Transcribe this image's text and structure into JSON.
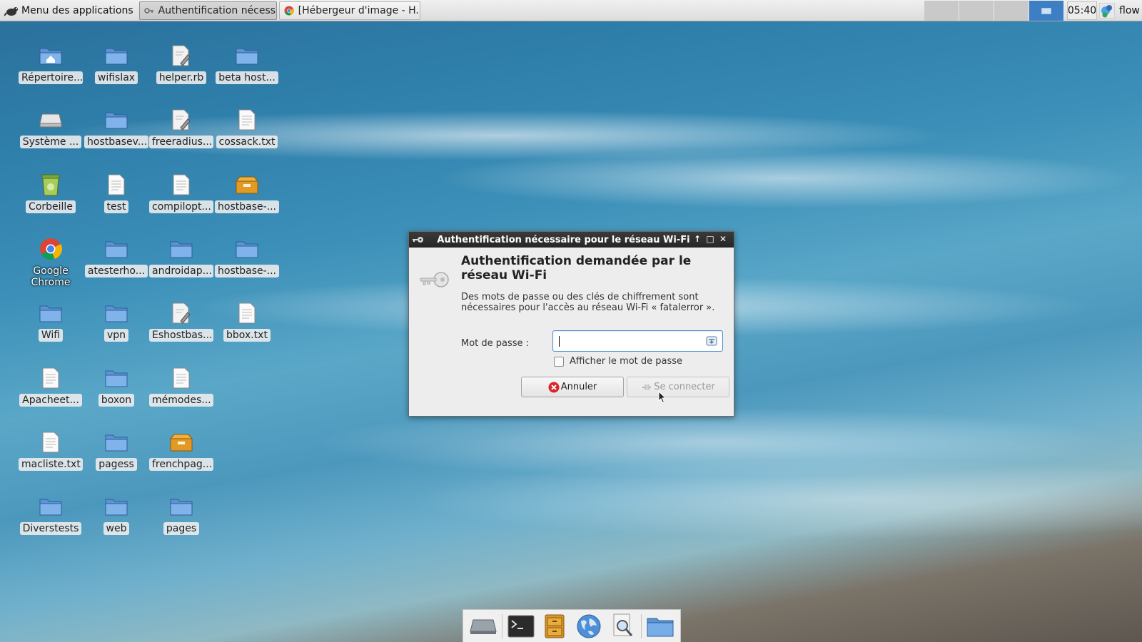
{
  "top_panel": {
    "app_menu_label": "Menu des applications",
    "tasks": [
      {
        "label": "Authentification nécess...",
        "active": true
      },
      {
        "label": "[Hébergeur d'image - H...",
        "active": false
      }
    ],
    "clock": "05:40",
    "user": "flow",
    "workspace_count": 4,
    "active_workspace": 4
  },
  "desktop": {
    "icons": [
      {
        "label": "Répertoire...",
        "type": "home-folder-icon"
      },
      {
        "label": "wifislax",
        "type": "folder-icon"
      },
      {
        "label": "helper.rb",
        "type": "script-file-icon"
      },
      {
        "label": "beta host...",
        "type": "folder-icon"
      },
      {
        "label": "Système ...",
        "type": "drive-icon"
      },
      {
        "label": "hostbasev...",
        "type": "folder-icon"
      },
      {
        "label": "freeradius...",
        "type": "script-file-icon"
      },
      {
        "label": "cossack.txt",
        "type": "text-file-icon"
      },
      {
        "label": "Corbeille",
        "type": "trash-icon"
      },
      {
        "label": "test",
        "type": "text-file-icon"
      },
      {
        "label": "compilopt...",
        "type": "text-file-icon"
      },
      {
        "label": "hostbase-...",
        "type": "package-icon"
      },
      {
        "label": "Google Chrome",
        "type": "chrome-icon"
      },
      {
        "label": "atesterho...",
        "type": "folder-icon"
      },
      {
        "label": "androidap...",
        "type": "folder-icon"
      },
      {
        "label": "hostbase-...",
        "type": "folder-icon"
      },
      {
        "label": "Wifi",
        "type": "folder-icon"
      },
      {
        "label": "vpn",
        "type": "folder-icon"
      },
      {
        "label": "Eshostbas...",
        "type": "script-file-icon"
      },
      {
        "label": "bbox.txt",
        "type": "text-file-icon"
      },
      {
        "label": "Apacheet...",
        "type": "text-file-icon"
      },
      {
        "label": "boxon",
        "type": "folder-icon"
      },
      {
        "label": "mémodes...",
        "type": "text-file-icon"
      },
      {
        "label": "macliste.txt",
        "type": "text-file-icon"
      },
      {
        "label": "pagess",
        "type": "folder-icon"
      },
      {
        "label": "frenchpag...",
        "type": "package-icon"
      },
      {
        "label": "Diverstests",
        "type": "folder-icon"
      },
      {
        "label": "web",
        "type": "folder-icon"
      },
      {
        "label": "pages",
        "type": "folder-icon"
      }
    ]
  },
  "dialog": {
    "title": "Authentification nécessaire pour le réseau Wi-Fi",
    "heading": "Authentification demandée par le réseau Wi-Fi",
    "description": "Des mots de passe ou des clés de chiffrement sont nécessaires pour l'accès au réseau Wi-Fi « fatalerror ».",
    "password_label": "Mot de passe :",
    "password_value": "",
    "show_password_label": "Afficher le mot de passe",
    "show_password_checked": false,
    "cancel_label": "Annuler",
    "connect_label": "Se connecter",
    "connect_enabled": false
  },
  "dock": {
    "items": [
      "drive-icon",
      "terminal-icon",
      "file-cabinet-icon",
      "web-browser-icon",
      "search-icon",
      "folder-icon"
    ]
  },
  "colors": {
    "dialog_title_bar": "#2e2e2e",
    "active_workspace": "#3d7fc4",
    "input_focus": "#4a90d9"
  }
}
